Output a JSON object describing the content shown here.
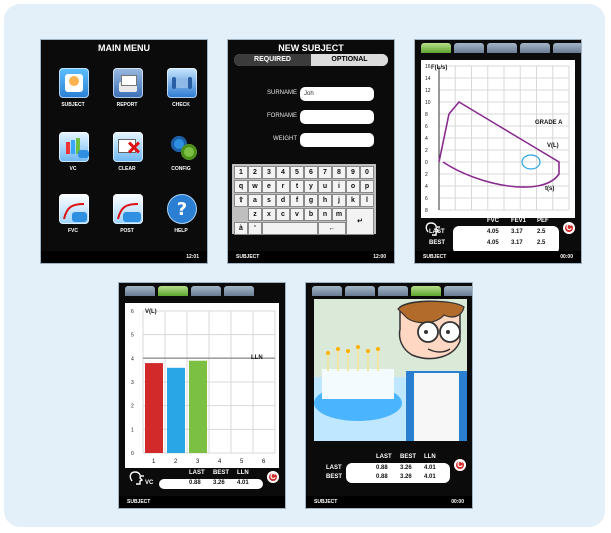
{
  "colors": {
    "panel_bg": "#e3f0f9",
    "screen_bg": "#0b0b0b",
    "accent_red": "#d22a2a",
    "accent_blue": "#28a6e5",
    "accent_green": "#7bc043",
    "purple_curve": "#8a2b8f"
  },
  "main_menu": {
    "title": "MAIN MENU",
    "status_time": "12:01",
    "items": [
      {
        "label": "SUBJECT",
        "icon": "subject-icon"
      },
      {
        "label": "REPORT",
        "icon": "report-icon"
      },
      {
        "label": "CHECK",
        "icon": "check-icon"
      },
      {
        "label": "VC",
        "icon": "vc-icon"
      },
      {
        "label": "CLEAR",
        "icon": "clear-icon"
      },
      {
        "label": "CONFIG",
        "icon": "config-icon"
      },
      {
        "label": "FVC",
        "icon": "fvc-icon"
      },
      {
        "label": "POST",
        "icon": "post-icon"
      },
      {
        "label": "HELP",
        "icon": "help-icon"
      }
    ]
  },
  "new_subject": {
    "title": "NEW SUBJECT",
    "tabs": [
      "REQUIRED",
      "OPTIONAL"
    ],
    "fields": [
      {
        "label": "SURNAME",
        "value": "Joh"
      },
      {
        "label": "FORNAME",
        "value": ""
      },
      {
        "label": "WEIGHT",
        "value": ""
      }
    ],
    "keyboard": {
      "row1": [
        "1",
        "2",
        "3",
        "4",
        "5",
        "6",
        "7",
        "8",
        "9",
        "0"
      ],
      "row2": [
        "q",
        "w",
        "e",
        "r",
        "t",
        "y",
        "u",
        "i",
        "o",
        "p"
      ],
      "row3": [
        "a",
        "s",
        "d",
        "f",
        "g",
        "h",
        "j",
        "k",
        "l"
      ],
      "row4": [
        "z",
        "x",
        "c",
        "v",
        "b",
        "n",
        "m"
      ],
      "row5": [
        "à",
        "'"
      ]
    },
    "status_left": "SUBJECT",
    "status_time": "12:00"
  },
  "fv_screen": {
    "y_label": "F(L/s)",
    "x_label": "t(s)",
    "v_label": "V(L)",
    "grade": "GRADE A",
    "table": {
      "headers": [
        "FVC",
        "FEV1",
        "PEF"
      ],
      "rows": [
        {
          "label": "LAST",
          "values": [
            "4.05",
            "3.17",
            "2.5"
          ]
        },
        {
          "label": "BEST",
          "values": [
            "4.05",
            "3.17",
            "2.5"
          ]
        }
      ]
    },
    "status_left": "SUBJECT",
    "status_time": "00:00"
  },
  "vc_screen": {
    "y_label": "V(L)",
    "lln_label": "LLN",
    "table": {
      "headers": [
        "LAST",
        "BEST",
        "LLN"
      ],
      "rows": [
        {
          "label": "VC",
          "values": [
            "0.88",
            "3.26",
            "4.01"
          ]
        }
      ]
    },
    "status_left": "SUBJECT",
    "status_time": ""
  },
  "cartoon_screen": {
    "table": {
      "headers": [
        "LAST",
        "BEST",
        "LLN"
      ],
      "rows": [
        {
          "label": "LAST",
          "values": [
            "0.88",
            "3.26",
            "4.01"
          ]
        },
        {
          "label": "BEST",
          "values": [
            "0.88",
            "3.26",
            "4.01"
          ]
        }
      ]
    },
    "status_left": "SUBJECT",
    "status_time": "00:00"
  },
  "chart_data": [
    {
      "type": "line",
      "title": "",
      "xlabel": "t(s)",
      "ylabel": "F(L/s)",
      "ylim": [
        -8,
        16
      ],
      "y_ticks": [
        16,
        14,
        12,
        10,
        8,
        6,
        4,
        2,
        0,
        2,
        4,
        6,
        8
      ],
      "series": [
        {
          "values": [
            [
              0,
              0
            ],
            [
              0.5,
              8
            ],
            [
              1,
              10
            ],
            [
              2,
              8
            ],
            [
              3,
              6
            ],
            [
              4,
              4
            ],
            [
              5,
              2
            ],
            [
              6,
              0
            ]
          ]
        }
      ]
    },
    {
      "type": "bar",
      "title": "",
      "xlabel": "",
      "ylabel": "V(L)",
      "categories": [
        "1",
        "2",
        "3",
        "4",
        "5",
        "6"
      ],
      "values": [
        3.8,
        3.6,
        3.9,
        null,
        null,
        null
      ],
      "ylim": [
        0,
        6
      ],
      "y_ticks": [
        "0",
        "1",
        "2",
        "3",
        "4",
        "5",
        "6"
      ],
      "threshold": {
        "label": "LLN",
        "value": 4.01
      }
    }
  ]
}
